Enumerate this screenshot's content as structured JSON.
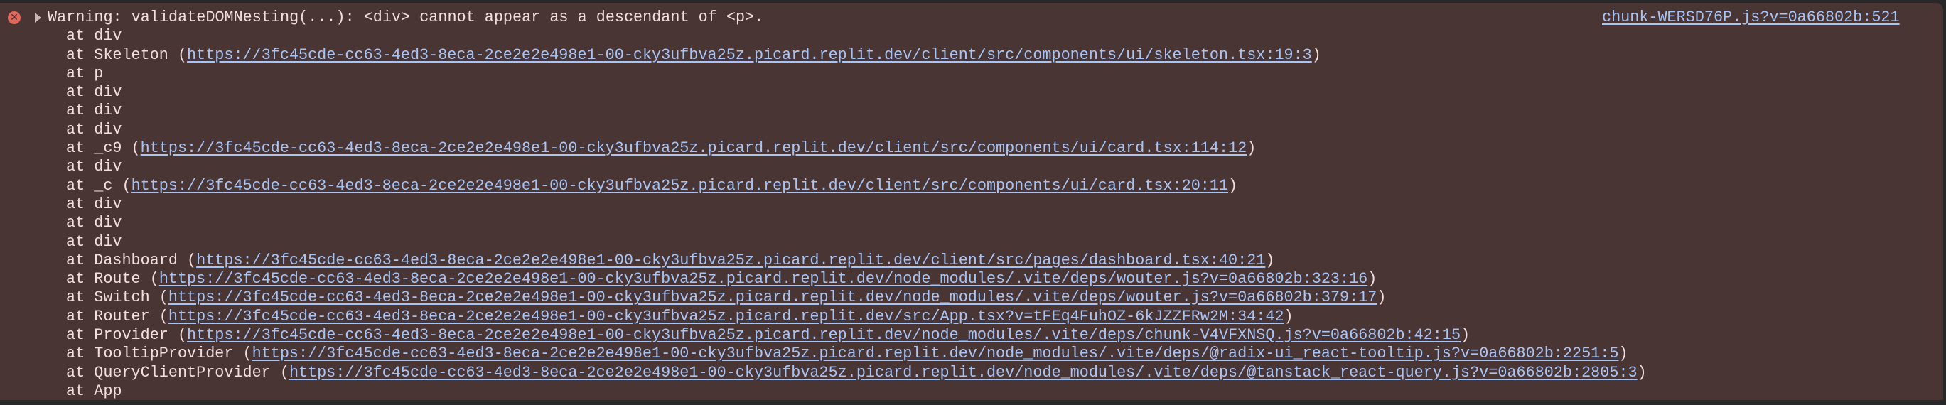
{
  "message": {
    "level": "error",
    "text": "Warning: validateDOMNesting(...): <div> cannot appear as a descendant of <p>.",
    "source_link": "chunk-WERSD76P.js?v=0a66802b:521",
    "icons": {
      "level": "error-circle-icon",
      "expand": "disclosure-triangle-icon"
    },
    "colors": {
      "background": "#4a3535",
      "text": "#f2dede",
      "link": "#a8c4f5",
      "error_icon": "#e0685d"
    }
  },
  "stack": [
    {
      "prefix": "at div"
    },
    {
      "prefix": "at Skeleton (",
      "url": "https://3fc45cde-cc63-4ed3-8eca-2ce2e2e498e1-00-cky3ufbva25z.picard.replit.dev/client/src/components/ui/skeleton.tsx:19:3",
      "suffix": ")"
    },
    {
      "prefix": "at p"
    },
    {
      "prefix": "at div"
    },
    {
      "prefix": "at div"
    },
    {
      "prefix": "at div"
    },
    {
      "prefix": "at _c9 (",
      "url": "https://3fc45cde-cc63-4ed3-8eca-2ce2e2e498e1-00-cky3ufbva25z.picard.replit.dev/client/src/components/ui/card.tsx:114:12",
      "suffix": ")"
    },
    {
      "prefix": "at div"
    },
    {
      "prefix": "at _c (",
      "url": "https://3fc45cde-cc63-4ed3-8eca-2ce2e2e498e1-00-cky3ufbva25z.picard.replit.dev/client/src/components/ui/card.tsx:20:11",
      "suffix": ")"
    },
    {
      "prefix": "at div"
    },
    {
      "prefix": "at div"
    },
    {
      "prefix": "at div"
    },
    {
      "prefix": "at Dashboard (",
      "url": "https://3fc45cde-cc63-4ed3-8eca-2ce2e2e498e1-00-cky3ufbva25z.picard.replit.dev/client/src/pages/dashboard.tsx:40:21",
      "suffix": ")"
    },
    {
      "prefix": "at Route (",
      "url": "https://3fc45cde-cc63-4ed3-8eca-2ce2e2e498e1-00-cky3ufbva25z.picard.replit.dev/node_modules/.vite/deps/wouter.js?v=0a66802b:323:16",
      "suffix": ")"
    },
    {
      "prefix": "at Switch (",
      "url": "https://3fc45cde-cc63-4ed3-8eca-2ce2e2e498e1-00-cky3ufbva25z.picard.replit.dev/node_modules/.vite/deps/wouter.js?v=0a66802b:379:17",
      "suffix": ")"
    },
    {
      "prefix": "at Router (",
      "url": "https://3fc45cde-cc63-4ed3-8eca-2ce2e2e498e1-00-cky3ufbva25z.picard.replit.dev/src/App.tsx?v=tFEq4FuhOZ-6kJZZFRw2M:34:42",
      "suffix": ")"
    },
    {
      "prefix": "at Provider (",
      "url": "https://3fc45cde-cc63-4ed3-8eca-2ce2e2e498e1-00-cky3ufbva25z.picard.replit.dev/node_modules/.vite/deps/chunk-V4VFXNSQ.js?v=0a66802b:42:15",
      "suffix": ")"
    },
    {
      "prefix": "at TooltipProvider (",
      "url": "https://3fc45cde-cc63-4ed3-8eca-2ce2e2e498e1-00-cky3ufbva25z.picard.replit.dev/node_modules/.vite/deps/@radix-ui_react-tooltip.js?v=0a66802b:2251:5",
      "suffix": ")"
    },
    {
      "prefix": "at QueryClientProvider (",
      "url": "https://3fc45cde-cc63-4ed3-8eca-2ce2e2e498e1-00-cky3ufbva25z.picard.replit.dev/node_modules/.vite/deps/@tanstack_react-query.js?v=0a66802b:2805:3",
      "suffix": ")"
    },
    {
      "prefix": "at App"
    }
  ]
}
